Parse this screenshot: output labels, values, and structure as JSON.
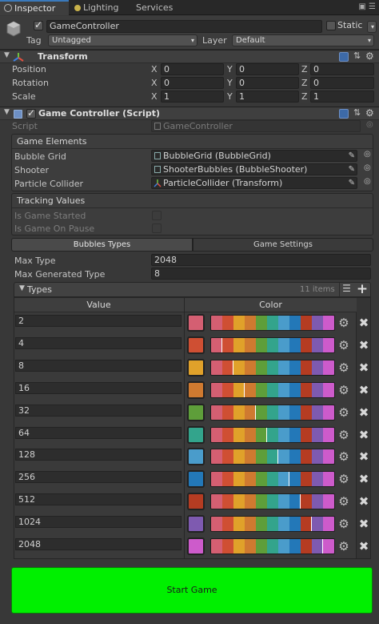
{
  "tabs": [
    {
      "label": "Inspector"
    },
    {
      "label": "Lighting"
    },
    {
      "label": "Services"
    }
  ],
  "object": {
    "name": "GameController",
    "static_label": "Static",
    "tag_label": "Tag",
    "tag_value": "Untagged",
    "layer_label": "Layer",
    "layer_value": "Default"
  },
  "transform": {
    "title": "Transform",
    "rows": [
      {
        "label": "Position",
        "x": "0",
        "y": "0",
        "z": "0"
      },
      {
        "label": "Rotation",
        "x": "0",
        "y": "0",
        "z": "0"
      },
      {
        "label": "Scale",
        "x": "1",
        "y": "1",
        "z": "1"
      }
    ]
  },
  "script_comp": {
    "title": "Game Controller (Script)",
    "script_label": "Script",
    "script_value": "GameController",
    "game_elements_header": "Game Elements",
    "elements": [
      {
        "label": "Bubble Grid",
        "value": "BubbleGrid (BubbleGrid)"
      },
      {
        "label": "Shooter",
        "value": "ShooterBubbles (BubbleShooter)"
      },
      {
        "label": "Particle Collider",
        "value": "ParticleCollider (Transform)"
      }
    ],
    "tracking_header": "Tracking Values",
    "tracking": [
      {
        "label": "Is Game Started"
      },
      {
        "label": "Is Game On Pause"
      }
    ],
    "subtabs": [
      "Bubbles Types",
      "Game Settings"
    ],
    "max_type_label": "Max Type",
    "max_type_value": "2048",
    "max_gen_label": "Max Generated Type",
    "max_gen_value": "8",
    "types_label": "Types",
    "types_count": "11 items",
    "col_value": "Value",
    "col_color": "Color"
  },
  "palette_colors": [
    "#d45f72",
    "#cf4f33",
    "#e0a12a",
    "#cf7a30",
    "#5e9e3a",
    "#33a48c",
    "#4a9ccb",
    "#2378b8",
    "#b53c22",
    "#7e5ab0",
    "#cd5bcb"
  ],
  "types": [
    {
      "value": "2",
      "color": "#d45f72"
    },
    {
      "value": "4",
      "color": "#cf4f33"
    },
    {
      "value": "8",
      "color": "#e0a12a"
    },
    {
      "value": "16",
      "color": "#cf7a30"
    },
    {
      "value": "32",
      "color": "#5e9e3a"
    },
    {
      "value": "64",
      "color": "#33a48c"
    },
    {
      "value": "128",
      "color": "#4a9ccb"
    },
    {
      "value": "256",
      "color": "#2378b8"
    },
    {
      "value": "512",
      "color": "#b53c22"
    },
    {
      "value": "1024",
      "color": "#7e5ab0"
    },
    {
      "value": "2048",
      "color": "#cd5bcb"
    }
  ],
  "start_button": "Start Game"
}
